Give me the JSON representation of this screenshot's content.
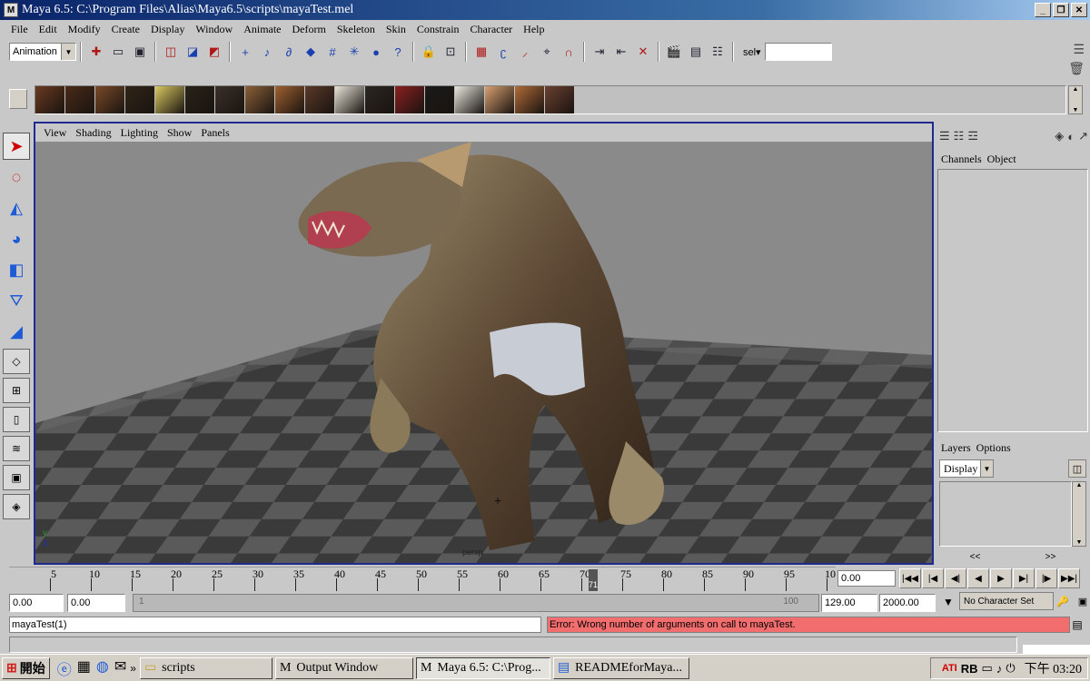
{
  "window": {
    "title": "Maya 6.5: C:\\Program Files\\Alias\\Maya6.5\\scripts\\mayaTest.mel",
    "app_icon": "M",
    "buttons": [
      "_",
      "❐",
      "✕"
    ]
  },
  "menubar": [
    "File",
    "Edit",
    "Modify",
    "Create",
    "Display",
    "Window",
    "Animate",
    "Deform",
    "Skeleton",
    "Skin",
    "Constrain",
    "Character",
    "Help"
  ],
  "statusline": {
    "mode": "Animation",
    "sel_label": "sel▾",
    "sel_value": ""
  },
  "shelf": {
    "hair_swatches": [
      "#6a3a20",
      "#4a2a18",
      "#7a4a28",
      "#302418",
      "#d8c860",
      "#282218",
      "#3a3028",
      "#8a6038",
      "#a06030",
      "#5a3828",
      "#e8e4d8",
      "#2a2620",
      "#8a2020",
      "#1a1a1a",
      "#e8e8e0",
      "#d8a070",
      "#b06a38",
      "#6a4030"
    ]
  },
  "viewport": {
    "panel_menu": [
      "View",
      "Shading",
      "Lighting",
      "Show",
      "Panels"
    ],
    "camera_label": "persp",
    "axis_y": "y",
    "axis_z": "z"
  },
  "channel_box": {
    "menu": [
      "Channels",
      "Object"
    ]
  },
  "layer_editor": {
    "menu": [
      "Layers",
      "Options"
    ],
    "display_value": "Display",
    "nav_left": "<<",
    "nav_right": ">>"
  },
  "timeline": {
    "labels": [
      "5",
      "10",
      "15",
      "20",
      "25",
      "30",
      "35",
      "40",
      "45",
      "50",
      "55",
      "60",
      "65",
      "70",
      "75",
      "80",
      "85",
      "90",
      "95",
      "10"
    ],
    "current_frame_marker": "71",
    "current_frame_field": "0.00"
  },
  "playback": [
    "|◀◀",
    "|◀",
    "◀|",
    "◀",
    "▶",
    "▶|",
    "|▶",
    "▶▶|"
  ],
  "range": {
    "start_time": "0.00",
    "playback_start": "0.00",
    "slider_start": "1",
    "slider_end": "100",
    "playback_end": "129.00",
    "end_time": "2000.00",
    "character_set": "No Character Set"
  },
  "command": {
    "input": "mayaTest(1)",
    "result": "Error: Wrong number of arguments on call to mayaTest."
  },
  "taskbar": {
    "start": "開始",
    "tasks": [
      {
        "label": "scripts",
        "active": false
      },
      {
        "label": "Output Window",
        "active": false
      },
      {
        "label": "Maya 6.5: C:\\Prog...",
        "active": true
      },
      {
        "label": "READMEforMaya...",
        "active": false
      }
    ],
    "tray_text": "RB",
    "clock": "下午 03:20"
  }
}
